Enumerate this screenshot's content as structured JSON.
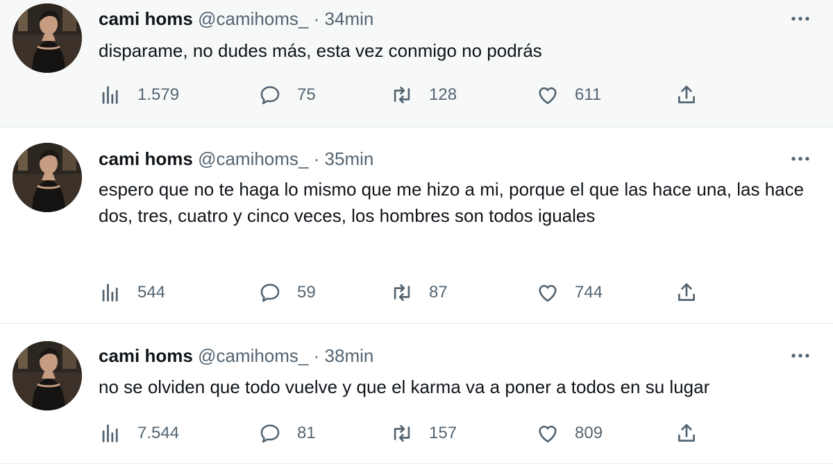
{
  "tweets": [
    {
      "author": "cami homs",
      "handle": "@camihoms_",
      "separator": "·",
      "time": "34min",
      "text": "disparame, no dudes más, esta vez conmigo no podrás",
      "views": "1.579",
      "replies": "75",
      "retweets": "128",
      "likes": "611"
    },
    {
      "author": "cami homs",
      "handle": "@camihoms_",
      "separator": "·",
      "time": "35min",
      "text": "espero que no te haga lo mismo que me hizo a mi, porque el que las hace una, las hace dos, tres, cuatro y cinco veces, los hombres son todos iguales",
      "views": "544",
      "replies": "59",
      "retweets": "87",
      "likes": "744"
    },
    {
      "author": "cami homs",
      "handle": "@camihoms_",
      "separator": "·",
      "time": "38min",
      "text": "no se olviden que todo vuelve y que el karma va a poner a todos en su lugar",
      "views": "7.544",
      "replies": "81",
      "retweets": "157",
      "likes": "809"
    }
  ],
  "icons": {
    "views": "bar-chart-icon",
    "reply": "speech-bubble-icon",
    "retweet": "retweet-icon",
    "like": "heart-icon",
    "share": "share-icon",
    "more": "more-horizontal-icon"
  },
  "colors": {
    "text": "#0f1419",
    "secondary": "#536471",
    "highlight_bg": "#f7f9f9",
    "divider": "#e6ecf0"
  }
}
